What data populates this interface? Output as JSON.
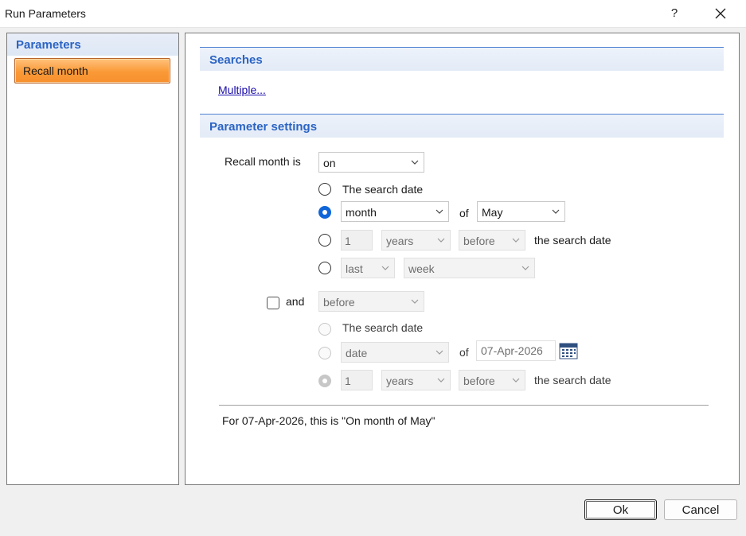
{
  "window": {
    "title": "Run Parameters",
    "help_label": "?"
  },
  "left_panel": {
    "header": "Parameters",
    "items": [
      {
        "label": "Recall month",
        "selected": true
      }
    ]
  },
  "searches": {
    "header": "Searches",
    "multiple_link": "Multiple..."
  },
  "param_settings": {
    "header": "Parameter settings",
    "recall_label": "Recall month is",
    "recall_mode": "on",
    "option1": {
      "label": "The search date",
      "selected": false
    },
    "option2": {
      "unit": "month",
      "of_label": "of",
      "month": "May",
      "selected": true
    },
    "option3": {
      "number": "1",
      "unit": "years",
      "direction": "before",
      "suffix": "the search date",
      "selected": false
    },
    "option4": {
      "which": "last",
      "unit": "week",
      "selected": false
    }
  },
  "and_section": {
    "checkbox_label": "and",
    "checked": false,
    "mode": "before",
    "option1": {
      "label": "The search date"
    },
    "option2": {
      "unit": "date",
      "of_label": "of",
      "date_value": "07-Apr-2026"
    },
    "option3": {
      "number": "1",
      "unit": "years",
      "direction": "before",
      "suffix": "the search date"
    }
  },
  "summary": "For 07-Apr-2026, this is \"On month of May\"",
  "buttons": {
    "ok": "Ok",
    "cancel": "Cancel"
  },
  "icons": {
    "help": "help-icon",
    "close": "close-icon",
    "chevron": "chevron-down-icon",
    "calendar": "calendar-icon"
  },
  "colors": {
    "accent_blue": "#2b64c4",
    "selected_orange": "#fa9937",
    "radio_blue": "#1066d8",
    "link": "#1a0dab"
  }
}
